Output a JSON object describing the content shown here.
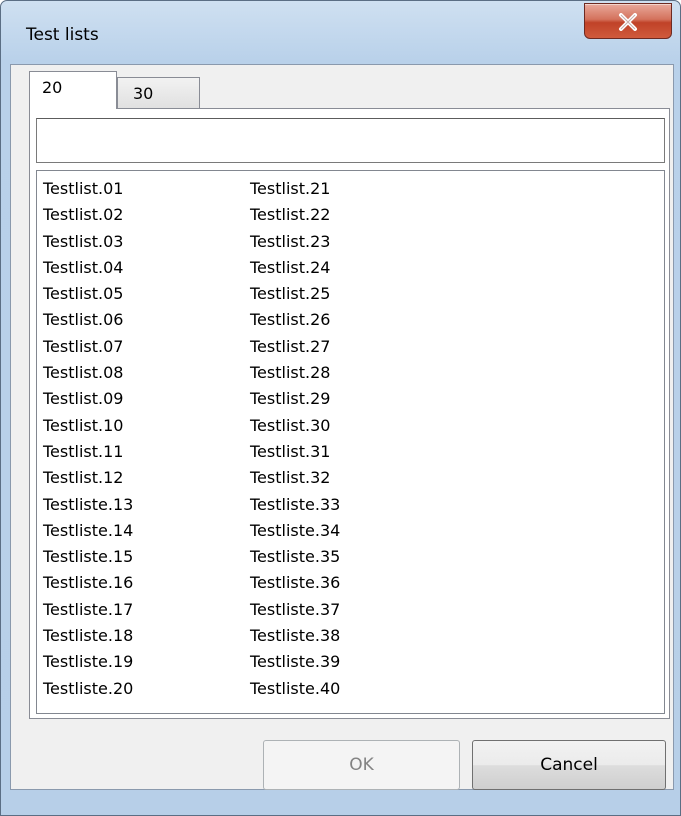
{
  "window": {
    "title": "Test lists"
  },
  "tabs": [
    {
      "label": "20",
      "active": true
    },
    {
      "label": "30",
      "active": false
    }
  ],
  "filter": {
    "value": "",
    "placeholder": ""
  },
  "list": {
    "column1": [
      "Testlist.01",
      "Testlist.02",
      "Testlist.03",
      "Testlist.04",
      "Testlist.05",
      "Testlist.06",
      "Testlist.07",
      "Testlist.08",
      "Testlist.09",
      "Testlist.10",
      "Testlist.11",
      "Testlist.12",
      "Testliste.13",
      "Testliste.14",
      "Testliste.15",
      "Testliste.16",
      "Testliste.17",
      "Testliste.18",
      "Testliste.19",
      "Testliste.20"
    ],
    "column2": [
      "Testlist.21",
      "Testlist.22",
      "Testlist.23",
      "Testlist.24",
      "Testlist.25",
      "Testlist.26",
      "Testlist.27",
      "Testlist.28",
      "Testlist.29",
      "Testlist.30",
      "Testlist.31",
      "Testlist.32",
      "Testliste.33",
      "Testliste.34",
      "Testliste.35",
      "Testliste.36",
      "Testliste.37",
      "Testliste.38",
      "Testliste.39",
      "Testliste.40"
    ]
  },
  "buttons": {
    "ok_label": "OK",
    "ok_disabled": true,
    "cancel_label": "Cancel"
  },
  "icons": {
    "close": "close-x-icon"
  },
  "colors": {
    "close_button": "#c8462d",
    "frame": "#b9d1ea",
    "client": "#f0f0f0"
  }
}
